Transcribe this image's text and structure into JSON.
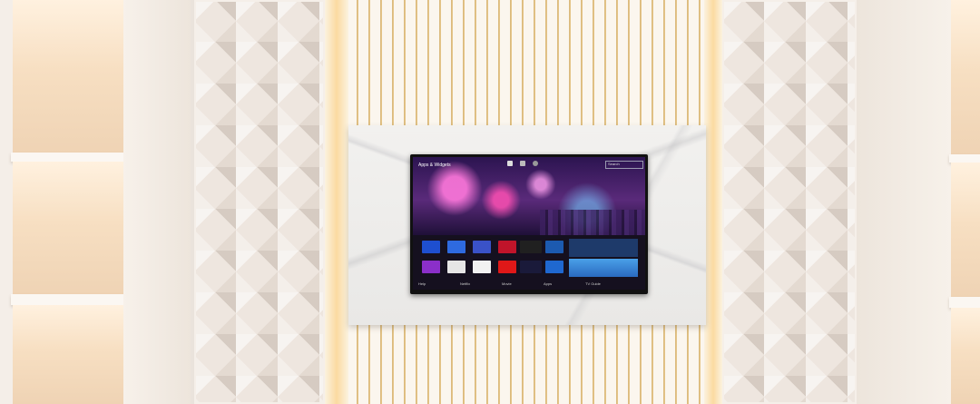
{
  "tv": {
    "header_title": "Apps & Widgets",
    "search_placeholder": "Search",
    "bottom_items": [
      "Help",
      "Netflix",
      "Movie",
      "Apps",
      "TV Guide"
    ]
  },
  "colors": {
    "wall": "#eae3dc",
    "gold_accent": "#d7b679",
    "marble": "#ecebe9",
    "tv_frame": "#111111"
  },
  "icons": [
    "app-tile-icon",
    "weather-widget-icon",
    "news-widget-icon"
  ]
}
